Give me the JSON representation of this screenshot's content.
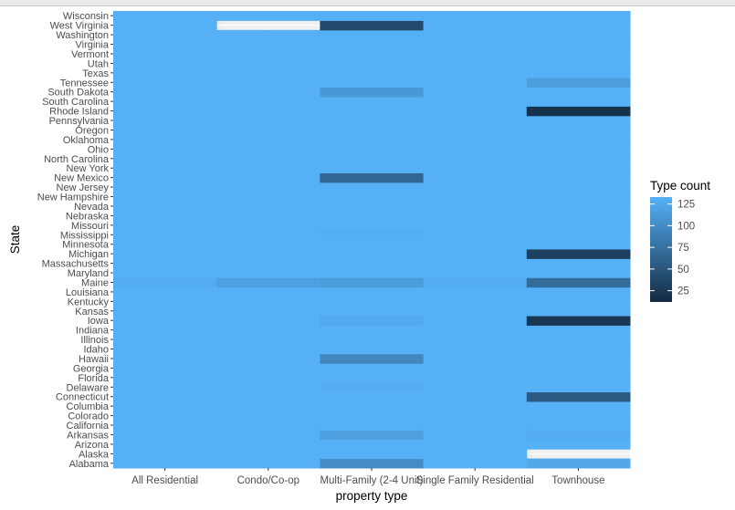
{
  "chart_data": {
    "type": "heatmap",
    "xlabel": "property type",
    "ylabel": "State",
    "x_categories": [
      "All Residential",
      "Condo/Co-op",
      "Multi-Family (2-4 Unit)",
      "Single Family Residential",
      "Townhouse"
    ],
    "y_categories": [
      "Alabama",
      "Alaska",
      "Arizona",
      "Arkansas",
      "California",
      "Colorado",
      "Columbia",
      "Connecticut",
      "Delaware",
      "Florida",
      "Georgia",
      "Hawaii",
      "Idaho",
      "Illinois",
      "Indiana",
      "Iowa",
      "Kansas",
      "Kentucky",
      "Louisiana",
      "Maine",
      "Maryland",
      "Massachusetts",
      "Michigan",
      "Minnesota",
      "Mississippi",
      "Missouri",
      "Nebraska",
      "Nevada",
      "New Hampshire",
      "New Jersey",
      "New Mexico",
      "New York",
      "North Carolina",
      "Ohio",
      "Oklahoma",
      "Oregon",
      "Pennsylvania",
      "Rhode Island",
      "South Carolina",
      "South Dakota",
      "Tennessee",
      "Texas",
      "Utah",
      "Vermont",
      "Virginia",
      "Washington",
      "West Virginia",
      "Wisconsin"
    ],
    "default_value": 132,
    "cells": [
      {
        "y": "Alabama",
        "x": "Multi-Family (2-4 Unit)",
        "value": 100
      },
      {
        "y": "Alabama",
        "x": "Townhouse",
        "value": 125
      },
      {
        "y": "Alaska",
        "x": "Townhouse",
        "value": null
      },
      {
        "y": "Arkansas",
        "x": "Multi-Family (2-4 Unit)",
        "value": 118
      },
      {
        "y": "Arkansas",
        "x": "Townhouse",
        "value": 128
      },
      {
        "y": "Connecticut",
        "x": "Townhouse",
        "value": 55
      },
      {
        "y": "Delaware",
        "x": "Multi-Family (2-4 Unit)",
        "value": 129
      },
      {
        "y": "Hawaii",
        "x": "Multi-Family (2-4 Unit)",
        "value": 95
      },
      {
        "y": "Iowa",
        "x": "Multi-Family (2-4 Unit)",
        "value": 126
      },
      {
        "y": "Iowa",
        "x": "Townhouse",
        "value": 22
      },
      {
        "y": "Maine",
        "x": "All Residential",
        "value": 128
      },
      {
        "y": "Maine",
        "x": "Condo/Co-op",
        "value": 118
      },
      {
        "y": "Maine",
        "x": "Multi-Family (2-4 Unit)",
        "value": 115
      },
      {
        "y": "Maine",
        "x": "Single Family Residential",
        "value": 128
      },
      {
        "y": "Maine",
        "x": "Townhouse",
        "value": 70
      },
      {
        "y": "Michigan",
        "x": "Townhouse",
        "value": 30
      },
      {
        "y": "Mississippi",
        "x": "Multi-Family (2-4 Unit)",
        "value": 130
      },
      {
        "y": "New Mexico",
        "x": "Multi-Family (2-4 Unit)",
        "value": 65
      },
      {
        "y": "Rhode Island",
        "x": "Townhouse",
        "value": 18
      },
      {
        "y": "South Dakota",
        "x": "Multi-Family (2-4 Unit)",
        "value": 110
      },
      {
        "y": "Tennessee",
        "x": "Townhouse",
        "value": 115
      },
      {
        "y": "West Virginia",
        "x": "Condo/Co-op",
        "value": null
      },
      {
        "y": "West Virginia",
        "x": "Multi-Family (2-4 Unit)",
        "value": 40
      }
    ],
    "legend": {
      "title": "Type count",
      "breaks": [
        25,
        50,
        75,
        100,
        125
      ],
      "range": [
        12,
        133
      ],
      "low_color": "#132B43",
      "high_color": "#56B1F7",
      "placement": "right"
    },
    "missing_color": "#f0f0f0",
    "panel_color": "#ebebeb",
    "grid_color": "#ffffff",
    "axis_text_color": "#4d4d4d",
    "axis_title_color": "#000000"
  }
}
